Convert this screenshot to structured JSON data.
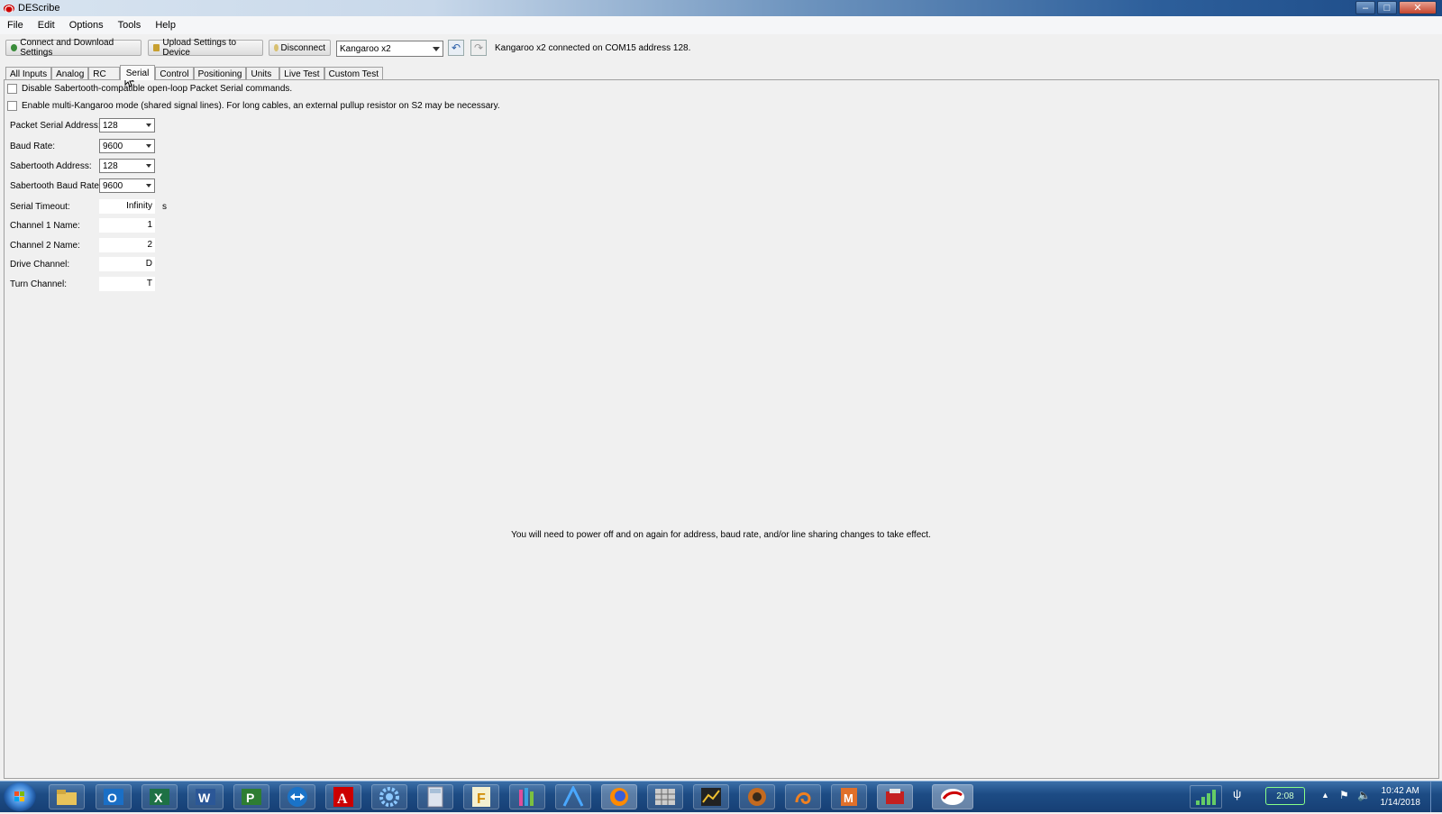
{
  "window": {
    "title": "DEScribe"
  },
  "menu": [
    "File",
    "Edit",
    "Options",
    "Tools",
    "Help"
  ],
  "toolbar": {
    "connect_label": "Connect and Download Settings",
    "upload_label": "Upload Settings to Device",
    "disconnect_label": "Disconnect",
    "device_selected": "Kangaroo x2",
    "status_text": "Kangaroo x2 connected on COM15 address 128."
  },
  "tabs": [
    "All Inputs",
    "Analog",
    "RC",
    "Serial",
    "Control",
    "Positioning",
    "Units",
    "Live Test",
    "Custom Test"
  ],
  "active_tab": "Serial",
  "serial": {
    "checkbox1_label": "Disable Sabertooth-compatible open-loop Packet Serial commands.",
    "checkbox1_checked": false,
    "checkbox2_label": "Enable multi-Kangaroo mode (shared signal lines). For long cables, an external pullup resistor on S2 may be necessary.",
    "checkbox2_checked": false,
    "packet_serial_address_label": "Packet Serial Address:",
    "packet_serial_address": "128",
    "baud_rate_label": "Baud Rate:",
    "baud_rate": "9600",
    "sabertooth_address_label": "Sabertooth Address:",
    "sabertooth_address": "128",
    "sabertooth_baud_rate_label": "Sabertooth Baud Rate:",
    "sabertooth_baud_rate": "9600",
    "serial_timeout_label": "Serial Timeout:",
    "serial_timeout": "Infinity",
    "serial_timeout_unit": "s",
    "channel1_name_label": "Channel 1 Name:",
    "channel1_name": "1",
    "channel2_name_label": "Channel 2 Name:",
    "channel2_name": "2",
    "drive_channel_label": "Drive Channel:",
    "drive_channel": "D",
    "turn_channel_label": "Turn Channel:",
    "turn_channel": "T",
    "notice": "You will need to power off and on again for address, baud rate, and/or line sharing changes to take effect."
  },
  "taskbar": {
    "icons": [
      "windows-explorer",
      "outlook",
      "excel",
      "word",
      "project",
      "teamviewer",
      "acrobat",
      "settings",
      "calculator",
      "app-f",
      "app-bars",
      "app-a",
      "firefox",
      "spreadsheet-app",
      "app-chart",
      "app-circle",
      "app-swirl",
      "app-m",
      "app-red",
      "describe"
    ],
    "battery_text": "2:08",
    "time": "10:42 AM",
    "date": "1/14/2018"
  },
  "colors": {
    "taskbar": "#1d4c85",
    "titlebar_accent": "#2d5f9b",
    "background": "#f0f0f0"
  }
}
